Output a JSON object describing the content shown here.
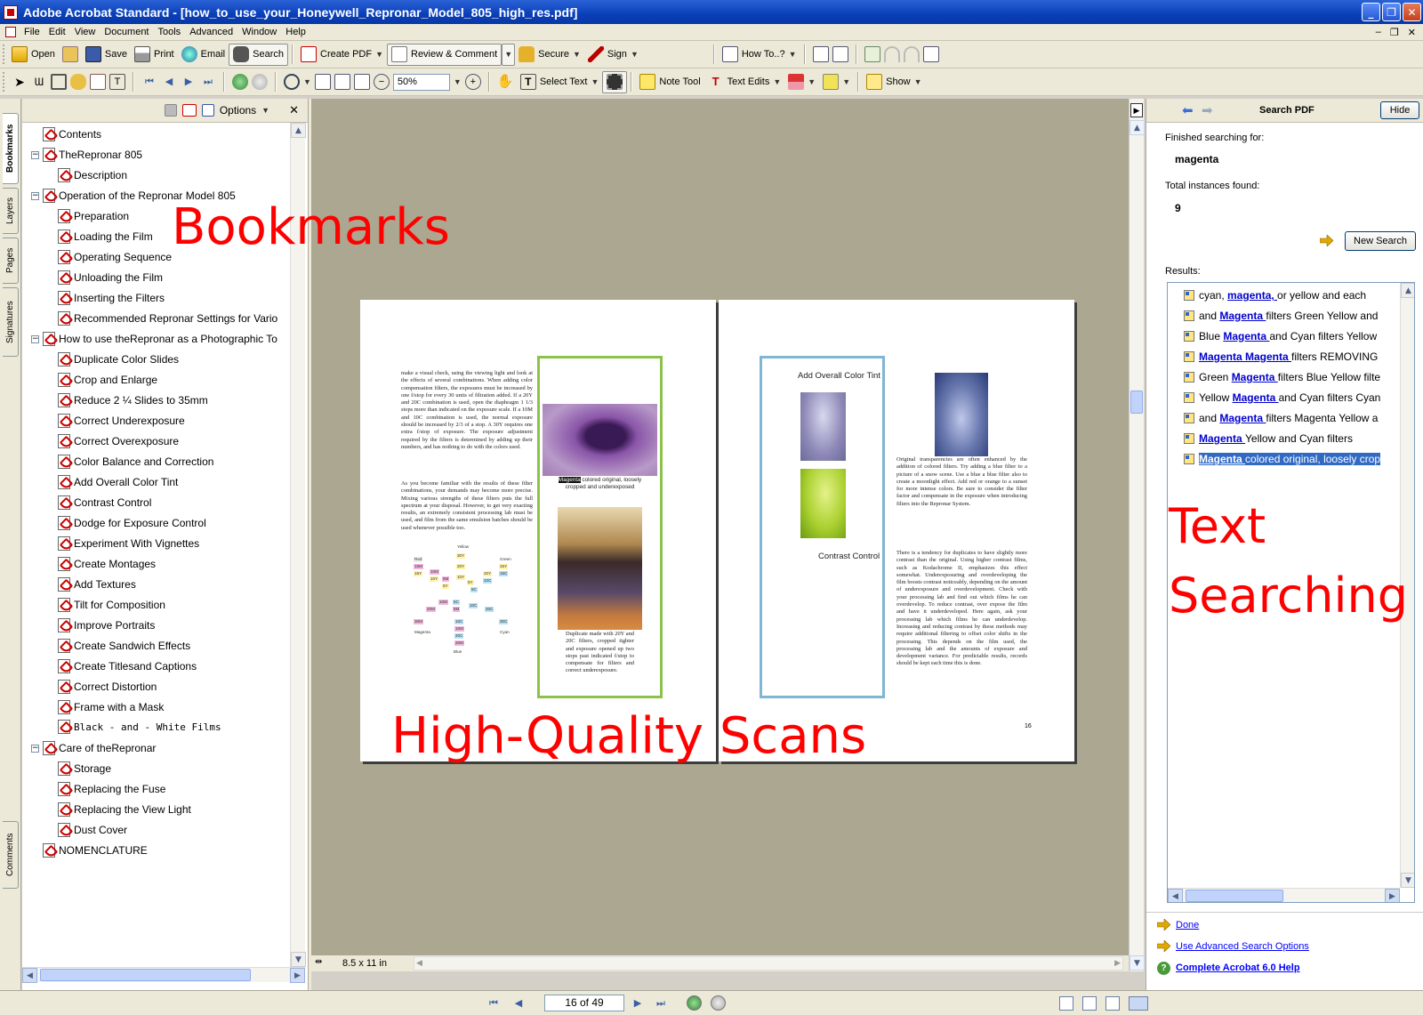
{
  "window": {
    "title": "Adobe Acrobat Standard - [how_to_use_your_Honeywell_Repronar_Model_805_high_res.pdf]"
  },
  "menu": [
    "File",
    "Edit",
    "View",
    "Document",
    "Tools",
    "Advanced",
    "Window",
    "Help"
  ],
  "toolbar1": {
    "open": "Open",
    "save": "Save",
    "print": "Print",
    "email": "Email",
    "search": "Search",
    "create_pdf": "Create PDF",
    "review": "Review & Comment",
    "secure": "Secure",
    "sign": "Sign",
    "howto": "How To..?"
  },
  "toolbar2": {
    "zoom": "50%",
    "select_text": "Select Text",
    "note_tool": "Note Tool",
    "text_edits": "Text Edits",
    "show": "Show"
  },
  "nav_tabs": [
    "Bookmarks",
    "Layers",
    "Pages",
    "Signatures",
    "Comments"
  ],
  "bookmarks_panel": {
    "options": "Options"
  },
  "bookmarks": [
    {
      "label": "Contents",
      "level": 0,
      "expander": ""
    },
    {
      "label": "TheRepronar 805",
      "level": 0,
      "expander": "−"
    },
    {
      "label": "Description",
      "level": 1,
      "expander": ""
    },
    {
      "label": "Operation of the Repronar Model 805",
      "level": 0,
      "expander": "−"
    },
    {
      "label": "Preparation",
      "level": 1,
      "expander": ""
    },
    {
      "label": "Loading the Film",
      "level": 1,
      "expander": ""
    },
    {
      "label": "Operating Sequence",
      "level": 1,
      "expander": ""
    },
    {
      "label": "Unloading the Film",
      "level": 1,
      "expander": ""
    },
    {
      "label": "Inserting the Filters",
      "level": 1,
      "expander": ""
    },
    {
      "label": "Recommended Repronar Settings for Vario",
      "level": 1,
      "expander": ""
    },
    {
      "label": "How to use theRepronar as a Photographic To",
      "level": 0,
      "expander": "−"
    },
    {
      "label": "Duplicate Color Slides",
      "level": 1,
      "expander": ""
    },
    {
      "label": "Crop and Enlarge",
      "level": 1,
      "expander": ""
    },
    {
      "label": "Reduce 2 ¼ Slides to 35mm",
      "level": 1,
      "expander": ""
    },
    {
      "label": "Correct Underexposure",
      "level": 1,
      "expander": ""
    },
    {
      "label": "Correct Overexposure",
      "level": 1,
      "expander": ""
    },
    {
      "label": "Color Balance and Correction",
      "level": 1,
      "expander": ""
    },
    {
      "label": "Add Overall Color Tint",
      "level": 1,
      "expander": ""
    },
    {
      "label": "Contrast Control",
      "level": 1,
      "expander": ""
    },
    {
      "label": "Dodge for Exposure Control",
      "level": 1,
      "expander": ""
    },
    {
      "label": "Experiment With Vignettes",
      "level": 1,
      "expander": ""
    },
    {
      "label": "Create Montages",
      "level": 1,
      "expander": ""
    },
    {
      "label": "Add Textures",
      "level": 1,
      "expander": ""
    },
    {
      "label": "Tilt for Composition",
      "level": 1,
      "expander": ""
    },
    {
      "label": "Improve Portraits",
      "level": 1,
      "expander": ""
    },
    {
      "label": "Create Sandwich Effects",
      "level": 1,
      "expander": ""
    },
    {
      "label": "Create Titlesand Captions",
      "level": 1,
      "expander": ""
    },
    {
      "label": "Correct Distortion",
      "level": 1,
      "expander": ""
    },
    {
      "label": "Frame with a Mask",
      "level": 1,
      "expander": ""
    },
    {
      "label": "Black - and - White Films",
      "level": 1,
      "expander": ""
    },
    {
      "label": "Care of theRepronar",
      "level": 0,
      "expander": "−"
    },
    {
      "label": "Storage",
      "level": 1,
      "expander": ""
    },
    {
      "label": "Replacing the Fuse",
      "level": 1,
      "expander": ""
    },
    {
      "label": "Replacing the View Light",
      "level": 1,
      "expander": ""
    },
    {
      "label": "Dust Cover",
      "level": 1,
      "expander": ""
    },
    {
      "label": "NOMENCLATURE",
      "level": 0,
      "expander": ""
    }
  ],
  "overlays": {
    "bookmarks": "Bookmarks",
    "scans": "High-Quality Scans",
    "text": "Text",
    "searching": "Searching"
  },
  "pages": {
    "left": {
      "text1": "make a visual check, using the viewing light and look at the effects of several combinations. When adding color compensation filters, the exposures must be increased by one f/stop for every 30 units of filtration added. If a 20Y and 20C combination is used, open the diaphragm 1 1/3 stops more than indicated on the exposure scale. If a 10M and 10C combination is used, the normal exposure should be increased by 2/3 of a stop. A 30Y requires one extra f/stop of exposure. The exposure adjustment required by the filters is determined by adding up their numbers, and has nothing to do with the colors used.",
      "text2": "As you become familiar with the results of these filter combinations, your demands may become more precise. Mixing various strengths of these filters puts the full spectrum at your disposal. However, to get very exacting results, an extremely consistent processing lab must be used, and film from the same emulsion batches should be used whenever possible too.",
      "caption1_highlight": "Magenta",
      "caption1": " colored original, loosely cropped and underexposed",
      "caption2": "Duplicate made with 20Y and 20C filters, cropped tighter and exposure opened up two stops past indicated f/stop to compensate for filters and correct underexposure."
    },
    "right": {
      "tint_title": "Add Overall Color Tint",
      "contrast_title": "Contrast Control",
      "text1": "Original transparencies are often enhanced by the addition of colored filters. Try adding a blue filter to a picture of a snow scene. Use a blue a blue filter also to create a moonlight effect. Add red or orange to a sunset for more intense colors. Be sure to consider the filter factor and compensate in the exposure when introducing filters into the Repronar System.",
      "text2": "There is a tendency for duplicates to have slightly more contrast than the original. Using higher contrast films, such as Kodachrome II, emphasizes this effect somewhat. Underexposuring and overdeveloping the film boosts contrast noticeably, depending on the amount of underexposure and overdevelopment. Check with your processing lab and find out which films he can overdevelop. To reduce contrast, over expose the film and have it underdeveloped. Here again, ask your processing lab which films he can underdevelop. Increasing and reducing contrast by these methods may require additional filtering to offset color shifts in the processing. This depends on the film used, the processing lab and the amounts of exposure and development variance. For predictable results, records should be kept each time this is done.",
      "page_number": "16"
    }
  },
  "color_wheel": [
    "Yellow",
    "30Y",
    "20Y",
    "10Y",
    "Red",
    "15M",
    "15Y",
    "10M",
    "10Y",
    "5M",
    "5Y",
    "5Y",
    "5C",
    "10Y",
    "10C",
    "Green",
    "15Y",
    "15C",
    "10M",
    "5C",
    "5M",
    "10C",
    "20M",
    "20C",
    "30M",
    "10C",
    "10M",
    "20C",
    "20M",
    "30C",
    "Magenta",
    "Blue",
    "Cyan"
  ],
  "status": {
    "page_size": "8.5 x 11 in",
    "page_field": "16 of 49"
  },
  "search": {
    "panel_title": "Search PDF",
    "hide": "Hide",
    "finished_label": "Finished searching for:",
    "term": "magenta",
    "total_label": "Total instances found:",
    "total": "9",
    "new_search": "New Search",
    "results_label": "Results:",
    "results": [
      {
        "pre": "cyan, ",
        "hit": "magenta, ",
        "post": "or yellow and each"
      },
      {
        "pre": "and ",
        "hit": "Magenta ",
        "post": "filters Green Yellow and"
      },
      {
        "pre": "Blue ",
        "hit": "Magenta ",
        "post": "and Cyan filters Yellow"
      },
      {
        "pre": "",
        "hit": "Magenta Magenta ",
        "post": "filters REMOVING"
      },
      {
        "pre": "Green ",
        "hit": "Magenta ",
        "post": "filters Blue Yellow filte"
      },
      {
        "pre": "Yellow ",
        "hit": "Magenta ",
        "post": "and Cyan filters Cyan"
      },
      {
        "pre": "and ",
        "hit": "Magenta ",
        "post": "filters Magenta Yellow a"
      },
      {
        "pre": "",
        "hit": "Magenta ",
        "post": "Yellow and Cyan filters"
      },
      {
        "pre": "",
        "hit": "Magenta ",
        "post": "colored original, loosely crop"
      }
    ],
    "done": "Done",
    "advanced": "Use Advanced Search Options",
    "help": "Complete Acrobat 6.0 Help"
  },
  "colors": {
    "title_blue": "#0a3fb8",
    "chrome": "#ece9d8",
    "doc_bg": "#aba791",
    "overlay_red": "#ff0000",
    "selection": "#316ac5",
    "frame_green": "#8bc34a",
    "frame_blue": "#7eb6d4"
  }
}
